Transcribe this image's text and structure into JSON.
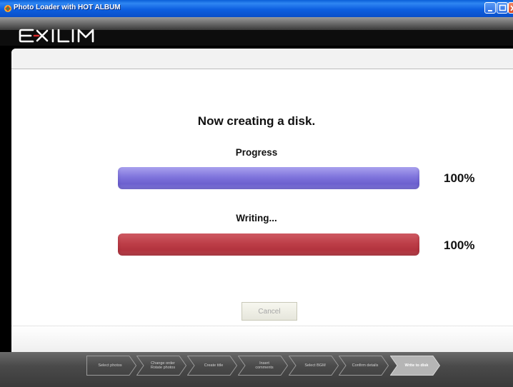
{
  "window": {
    "title": "Photo Loader with HOT ALBUM"
  },
  "brand": {
    "logo_text": "EXILIM"
  },
  "main": {
    "heading": "Now creating a disk.",
    "progress_label": "Progress",
    "progress_percent_text": "100%",
    "progress_value": 1.0,
    "writing_label": "Writing...",
    "writing_percent_text": "100%",
    "writing_value": 1.0,
    "cancel_label": "Cancel",
    "cancel_enabled": false
  },
  "colors": {
    "progress_bar": "#7f74dc",
    "writing_bar": "#b83a45",
    "stepbar_bg": "#4a4a4a"
  },
  "steps": [
    {
      "label": "Select photos",
      "active": false
    },
    {
      "label": "Change order\nRotate photos",
      "active": false
    },
    {
      "label": "Create title",
      "active": false
    },
    {
      "label": "Insert\ncomments",
      "active": false
    },
    {
      "label": "Select BGM",
      "active": false
    },
    {
      "label": "Confirm details",
      "active": false
    },
    {
      "label": "Write to disk",
      "active": true
    }
  ]
}
